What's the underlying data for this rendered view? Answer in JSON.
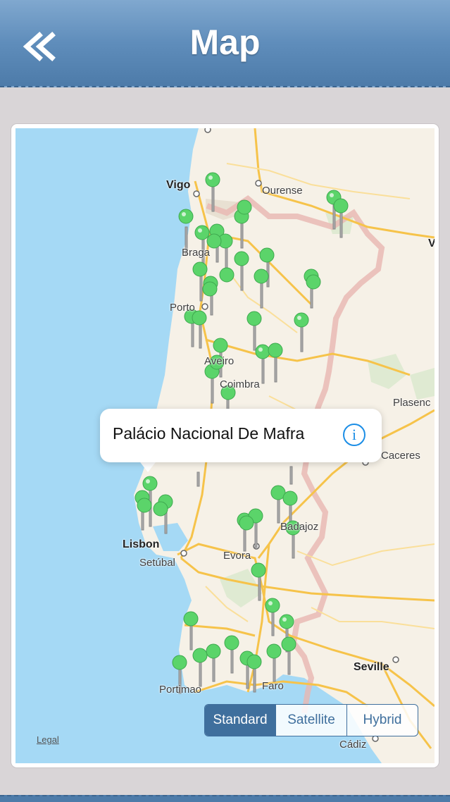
{
  "navbar": {
    "title": "Map",
    "back_icon": "double-chevron-left-icon"
  },
  "map": {
    "cities": [
      {
        "name": "Vigo",
        "big": true
      },
      {
        "name": "Ourense",
        "big": false
      },
      {
        "name": "Braga",
        "big": false
      },
      {
        "name": "Porto",
        "big": false
      },
      {
        "name": "Aveiro",
        "big": false
      },
      {
        "name": "Coimbra",
        "big": false
      },
      {
        "name": "Plasenc",
        "big": false
      },
      {
        "name": "Caceres",
        "big": false
      },
      {
        "name": "Badajoz",
        "big": false
      },
      {
        "name": "Lisbon",
        "big": true
      },
      {
        "name": "Setúbal",
        "big": false
      },
      {
        "name": "Evora",
        "big": false
      },
      {
        "name": "Portimao",
        "big": false
      },
      {
        "name": "Faro",
        "big": false
      },
      {
        "name": "Seville",
        "big": true
      },
      {
        "name": "Cádiz",
        "big": false
      },
      {
        "name": "V",
        "big": true
      }
    ],
    "pin_color": "#5bd46a",
    "legal_label": "Legal",
    "callout": {
      "title": "Palácio Nacional De Mafra",
      "info_icon": "info-icon"
    },
    "map_type": {
      "options": [
        "Standard",
        "Satellite",
        "Hybrid"
      ],
      "selected": "Standard"
    }
  },
  "colors": {
    "nav": "#5f8dbb",
    "accent": "#3f6f9d",
    "water": "#a5d9f5",
    "land": "#f6f1e7"
  }
}
